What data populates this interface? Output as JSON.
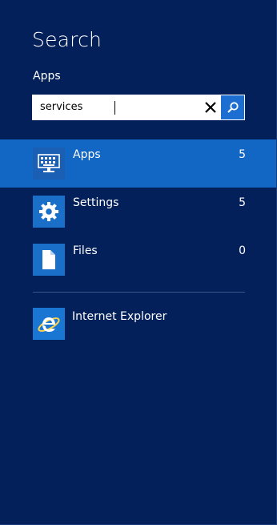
{
  "header": {
    "title": "Search",
    "scope": "Apps"
  },
  "search": {
    "value": "services",
    "clear_icon": "close-icon",
    "go_icon": "search-icon"
  },
  "categories": [
    {
      "label": "Apps",
      "count": "5",
      "icon": "apps-icon",
      "selected": true
    },
    {
      "label": "Settings",
      "count": "5",
      "icon": "gear-icon",
      "selected": false
    },
    {
      "label": "Files",
      "count": "0",
      "icon": "file-icon",
      "selected": false
    }
  ],
  "suggestions": [
    {
      "label": "Internet Explorer",
      "icon": "internet-explorer-icon"
    }
  ],
  "colors": {
    "background": "#03205a",
    "accent": "#1266c4",
    "tile": "#1a6fc8"
  }
}
